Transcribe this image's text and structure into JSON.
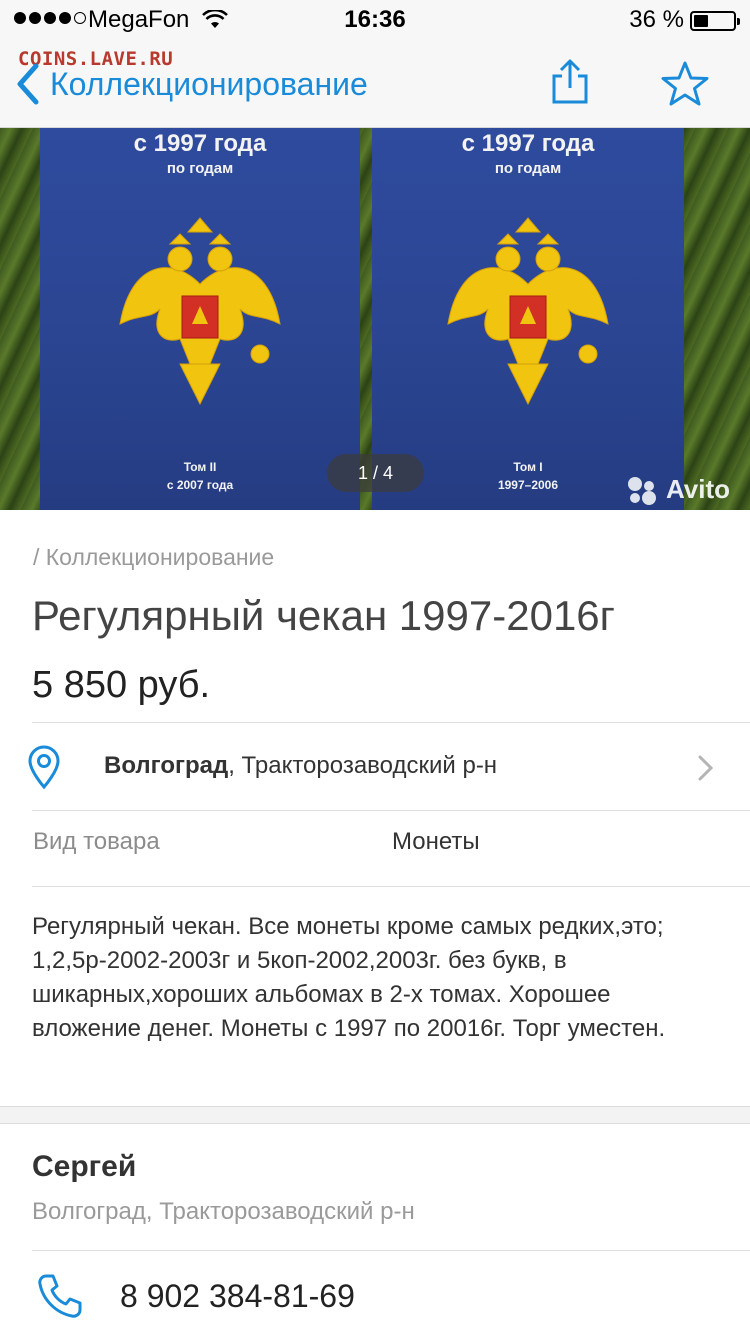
{
  "status_bar": {
    "carrier": "MegaFon",
    "time": "16:36",
    "battery_percent": "36 %",
    "battery_level": 0.36,
    "signal_bars": 4
  },
  "watermark": "COINS.LAVE.RU",
  "nav": {
    "back_label": "Коллекционирование",
    "share_icon": "share-icon",
    "favorite_icon": "star-icon",
    "accent_color": "#1a8bd8"
  },
  "gallery": {
    "counter": "1 / 4",
    "brand": "Avito",
    "books": [
      {
        "title_line1": "с 1997 года",
        "title_line2": "по годам",
        "volume": "Том II",
        "years": "с 2007 года"
      },
      {
        "title_line1": "с 1997 года",
        "title_line2": "по годам",
        "volume": "Том I",
        "years": "1997–2006"
      }
    ]
  },
  "listing": {
    "breadcrumb": "/ Коллекционирование",
    "title": "Регулярный чекан 1997-2016г",
    "price": "5 850 руб."
  },
  "location": {
    "city": "Волгоград",
    "district": ", Тракторозаводский р-н"
  },
  "params": {
    "label": "Вид товара",
    "value": "Монеты"
  },
  "description": "Регулярный чекан. Все монеты кроме самых редких,это; 1,2,5р-2002-2003г и 5коп-2002,2003г. без букв, в шикарных,хороших альбомах в 2-х томах. Хорошее вложение денег. Монеты с 1997 по 20016г. Торг уместен.",
  "seller": {
    "name": "Сергей",
    "location": "Волгоград, Тракторозаводский р-н",
    "phone": "8 902 384-81-69"
  }
}
